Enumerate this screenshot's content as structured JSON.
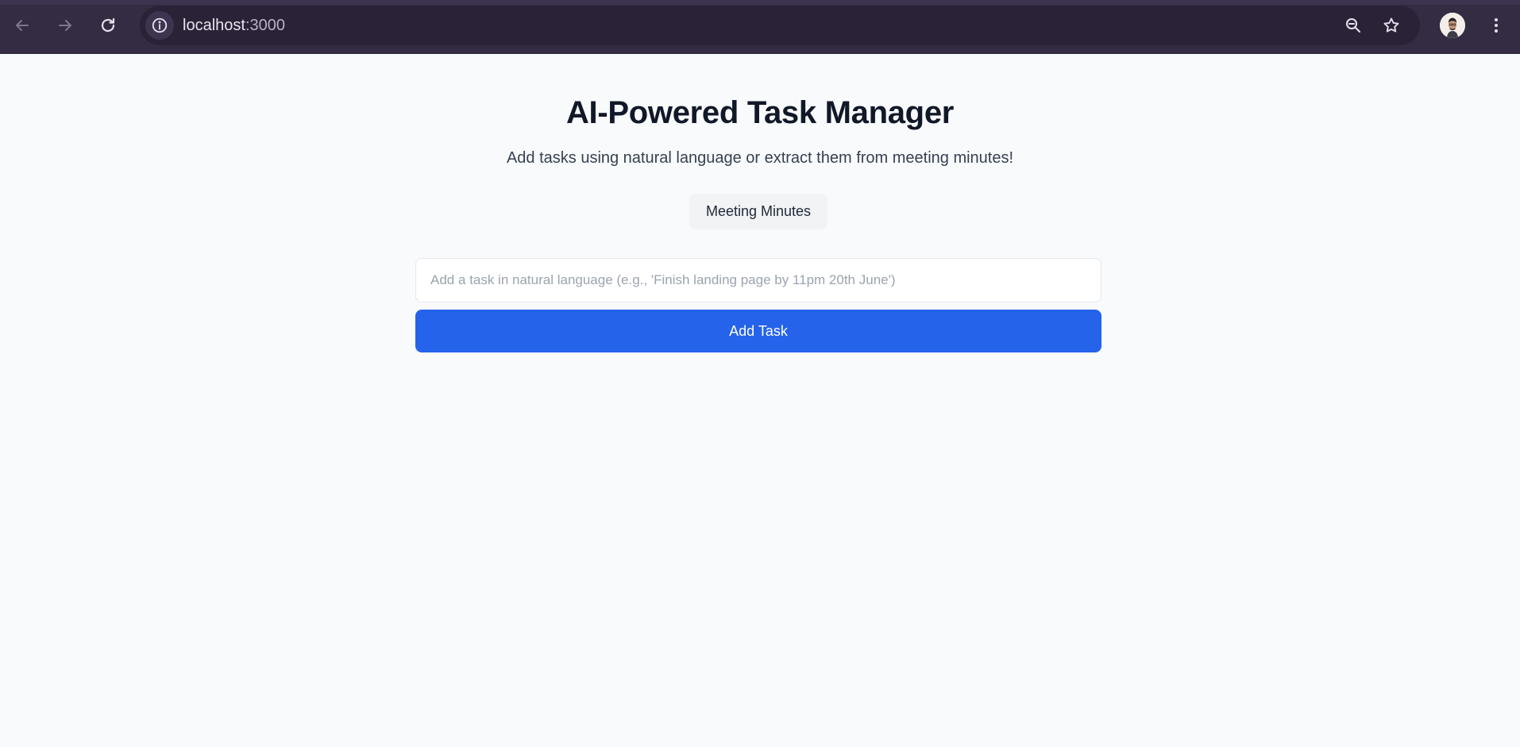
{
  "browser": {
    "url_host": "localhost",
    "url_port": ":3000",
    "icons": {
      "back": "back-arrow-icon",
      "forward": "forward-arrow-icon",
      "reload": "reload-icon",
      "site_info": "info-icon",
      "zoom": "zoom-out-icon",
      "bookmark": "star-icon",
      "menu": "kebab-menu-icon"
    }
  },
  "app": {
    "title": "AI-Powered Task Manager",
    "subtitle": "Add tasks using natural language or extract them from meeting minutes!",
    "meeting_minutes_label": "Meeting Minutes",
    "task_input": {
      "value": "",
      "placeholder": "Add a task in natural language (e.g., 'Finish landing page by 11pm 20th June')"
    },
    "add_task_label": "Add Task"
  },
  "colors": {
    "primary": "#2563eb",
    "chrome_bg": "#342c42",
    "page_bg": "#f8fafc"
  }
}
